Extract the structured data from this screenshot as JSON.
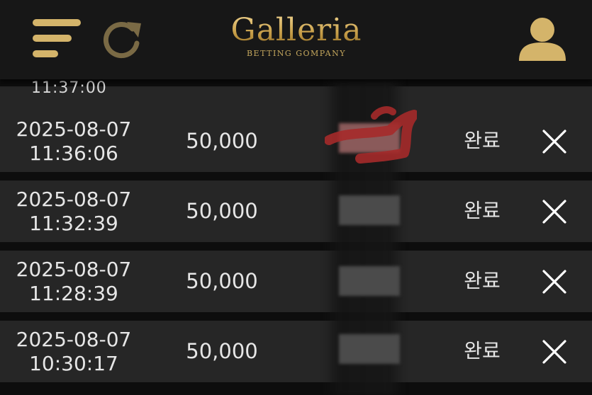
{
  "header": {
    "logo_main": "Galleria",
    "logo_sub": "BETTING GOMPANY",
    "icons": {
      "menu": "menu-icon",
      "refresh": "refresh-icon",
      "user": "user-icon"
    },
    "accent_color": "#d4b46a"
  },
  "partial_row": {
    "text": "11:37:00"
  },
  "rows": [
    {
      "date": "2025-08-07",
      "time": "11:36:06",
      "amount": "50,000",
      "status": "완료"
    },
    {
      "date": "2025-08-07",
      "time": "11:32:39",
      "amount": "50,000",
      "status": "완료"
    },
    {
      "date": "2025-08-07",
      "time": "11:28:39",
      "amount": "50,000",
      "status": "완료"
    },
    {
      "date": "2025-08-07",
      "time": "10:30:17",
      "amount": "50,000",
      "status": "완료"
    }
  ]
}
